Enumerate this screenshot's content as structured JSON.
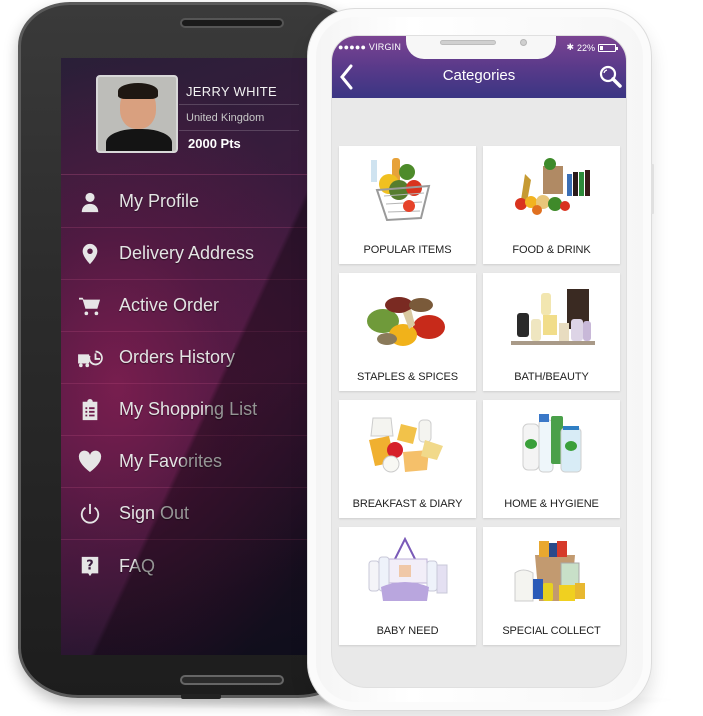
{
  "android_app": {
    "profile": {
      "name": "JERRY WHITE",
      "country": "United Kingdom",
      "points": "2000 Pts"
    },
    "menu": [
      {
        "label": "My Profile",
        "icon": "user-icon"
      },
      {
        "label": "Delivery Address",
        "icon": "map-pin-icon"
      },
      {
        "label": "Active Order",
        "icon": "cart-icon"
      },
      {
        "label": "Orders History",
        "icon": "delivery-history-icon"
      },
      {
        "label": "My Shopping List",
        "icon": "clipboard-list-icon"
      },
      {
        "label": "My Favorites",
        "icon": "heart-icon"
      },
      {
        "label": "Sign Out",
        "icon": "power-icon"
      },
      {
        "label": "FAQ",
        "icon": "question-icon"
      }
    ]
  },
  "ios_app": {
    "status_bar": {
      "carrier": "●●●●● VIRGIN",
      "bluetooth": "✱",
      "battery": "22%",
      "battery_level": 0.22
    },
    "header": {
      "title": "Categories",
      "back_icon": "chevron-left-icon",
      "search_icon": "search-icon"
    },
    "categories": [
      {
        "label": "POPULAR ITEMS"
      },
      {
        "label": "FOOD & DRINK"
      },
      {
        "label": "STAPLES & SPICES"
      },
      {
        "label": "BATH/BEAUTY"
      },
      {
        "label": "BREAKFAST & DIARY"
      },
      {
        "label": "HOME & HYGIENE"
      },
      {
        "label": "BABY NEED"
      },
      {
        "label": "SPECIAL COLLECT"
      }
    ]
  },
  "colors": {
    "header_top": "#7b4492",
    "header_bottom": "#3b3683",
    "drawer_accent": "#801e50"
  }
}
